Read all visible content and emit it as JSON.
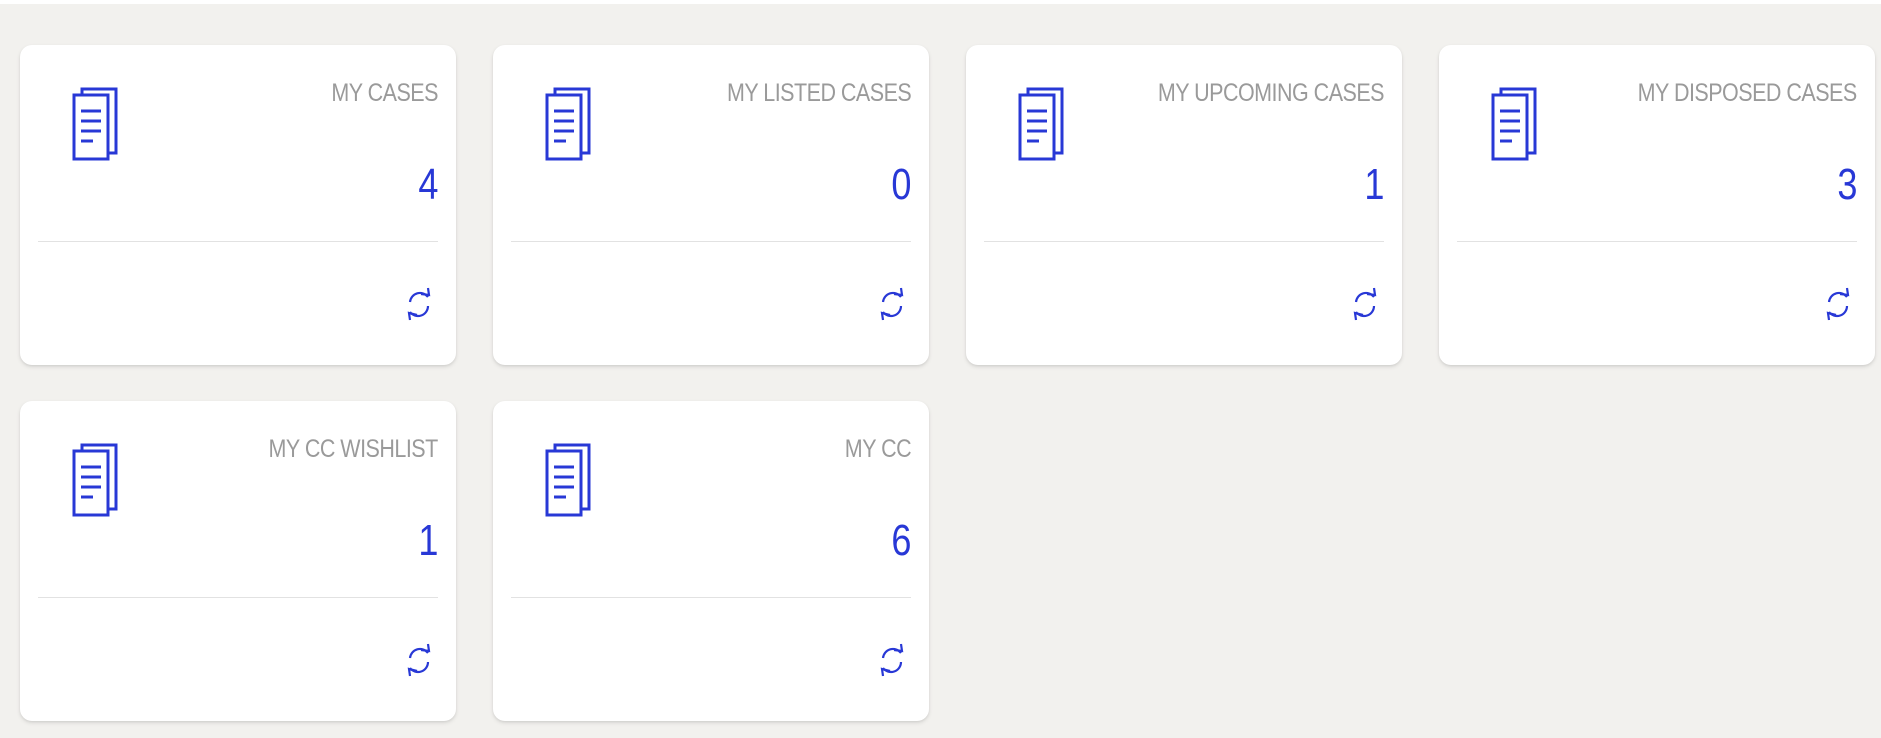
{
  "colors": {
    "background": "#f2f1ee",
    "accent": "#2838d6",
    "title": "#9a9a9a"
  },
  "cards": [
    {
      "title": "MY CASES",
      "count": "4",
      "icon": "document-stack-icon",
      "action_icon": "refresh-icon"
    },
    {
      "title": "MY LISTED CASES",
      "count": "0",
      "icon": "document-stack-icon",
      "action_icon": "refresh-icon"
    },
    {
      "title": "MY UPCOMING CASES",
      "count": "1",
      "icon": "document-stack-icon",
      "action_icon": "refresh-icon"
    },
    {
      "title": "MY DISPOSED CASES",
      "count": "3",
      "icon": "document-stack-icon",
      "action_icon": "refresh-icon"
    },
    {
      "title": "MY CC WISHLIST",
      "count": "1",
      "icon": "document-stack-icon",
      "action_icon": "refresh-icon"
    },
    {
      "title": "MY CC",
      "count": "6",
      "icon": "document-stack-icon",
      "action_icon": "refresh-icon"
    }
  ]
}
